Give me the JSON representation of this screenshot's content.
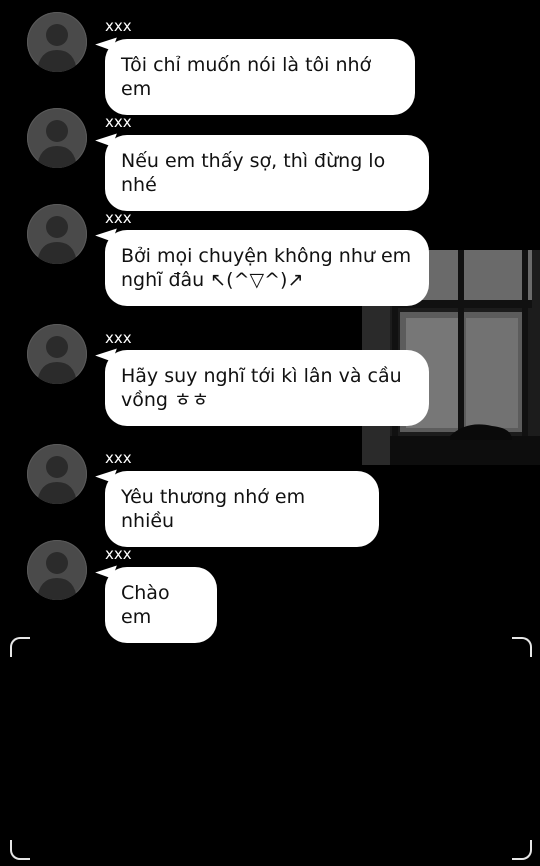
{
  "messages": [
    {
      "sender": "xxx",
      "text": "Tôi chỉ muốn nói là tôi nhớ em"
    },
    {
      "sender": "xxx",
      "text": "Nếu em thấy sợ, thì đừng lo nhé"
    },
    {
      "sender": "xxx",
      "text": "Bởi mọi chuyện không như em nghĩ đâu ↖(^▽^)↗"
    },
    {
      "sender": "xxx",
      "text": "Hãy suy nghĩ tới kì lân và cầu vồng ㅎㅎ"
    },
    {
      "sender": "xxx",
      "text": "Yêu thương nhớ em nhiều"
    },
    {
      "sender": "xxx",
      "text": "Chào em"
    }
  ],
  "icons": {
    "avatar": "default-person-icon"
  },
  "colors": {
    "background": "#000000",
    "bubble": "#ffffff",
    "avatar": "#4a4a4a",
    "frame": "#e6e6e6"
  }
}
